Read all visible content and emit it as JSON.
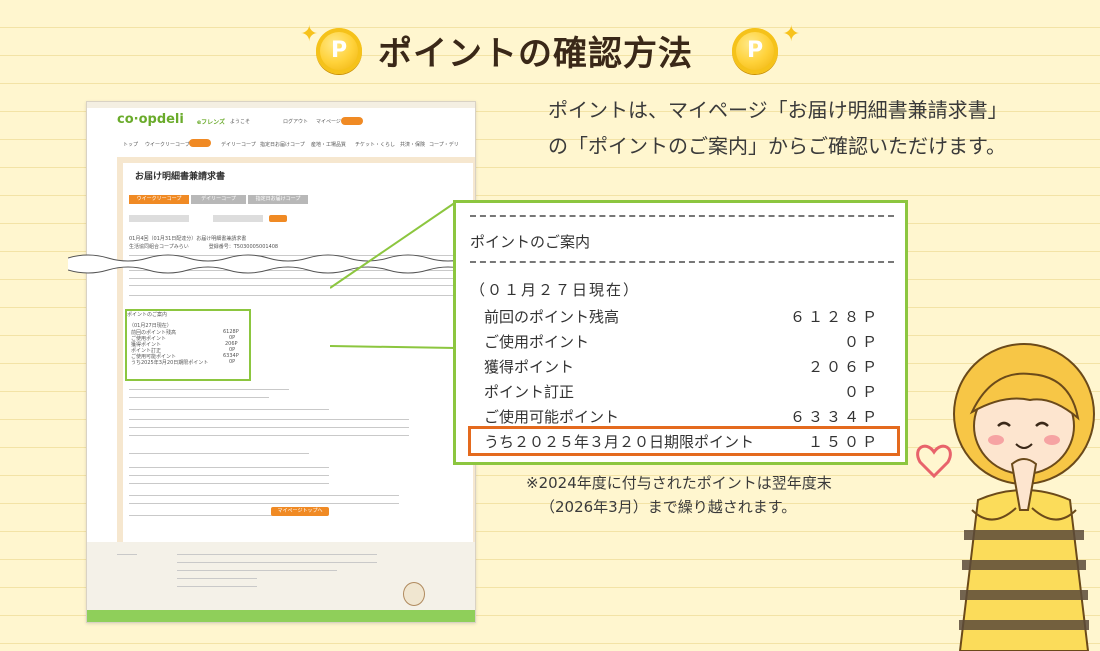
{
  "header": {
    "title": "ポイントの確認方法",
    "coin_label": "P"
  },
  "description": "ポイントは、マイページ「お届け明細書兼請求書」の「ポイントのご案内」からご確認いただけます。",
  "note": {
    "line1": "※2024年度に付与されたポイントは翌年度末",
    "line2": "（2026年3月）まで繰り越されます。"
  },
  "screenshot": {
    "logo": "co·opdeli",
    "logo_sub": "eフレンズ",
    "welcome": "ようこそ",
    "logout": "ログアウト",
    "mypage": "マイページ",
    "nav": [
      "トップ",
      "ウイークリーコープ",
      "デイリーコープ",
      "指定日お届けコープ",
      "産地・工場品質",
      "チケット・くらし",
      "共済・保険",
      "コープ・デリ"
    ],
    "page_title": "お届け明細書兼請求書",
    "tabs": [
      "ウイークリーコープ",
      "デイリーコープ",
      "指定日お届けコープ"
    ],
    "text_line_1": "01月4回（01月31日配達分）お届け明細書兼請求書",
    "text_line_2": "生活協同組合コープみらい　　　　登録番号：T5030005001408",
    "points_header": "ポイントのご案内",
    "points_date": "（01月27日現在）",
    "points_rows": [
      {
        "label": "前回のポイント残高",
        "value": "6128P"
      },
      {
        "label": "ご使用ポイント",
        "value": "0P"
      },
      {
        "label": "獲得ポイント",
        "value": "206P"
      },
      {
        "label": "ポイント訂正",
        "value": "0P"
      },
      {
        "label": "ご使用可能ポイント",
        "value": "6334P"
      },
      {
        "label": "うち2025年3月20日期限ポイント",
        "value": "0P"
      }
    ],
    "mypage_button": "マイページトップへ"
  },
  "zoom": {
    "header": "ポイントのご案内",
    "date": "（０１月２７日現在）",
    "rows": [
      {
        "label": "前回のポイント残高",
        "value": "６１２８Ｐ"
      },
      {
        "label": "ご使用ポイント",
        "value": "０Ｐ"
      },
      {
        "label": "獲得ポイント",
        "value": "２０６Ｐ"
      },
      {
        "label": "ポイント訂正",
        "value": "０Ｐ"
      },
      {
        "label": "ご使用可能ポイント",
        "value": "６３３４Ｐ"
      }
    ],
    "highlight_label": "うち２０２５年３月２０日期限ポイント",
    "highlight_value": "１５０Ｐ"
  },
  "colors": {
    "background": "#fff6cf",
    "accent_green": "#8cc63f",
    "accent_orange": "#e46a1e",
    "title_brown": "#3a2818"
  }
}
